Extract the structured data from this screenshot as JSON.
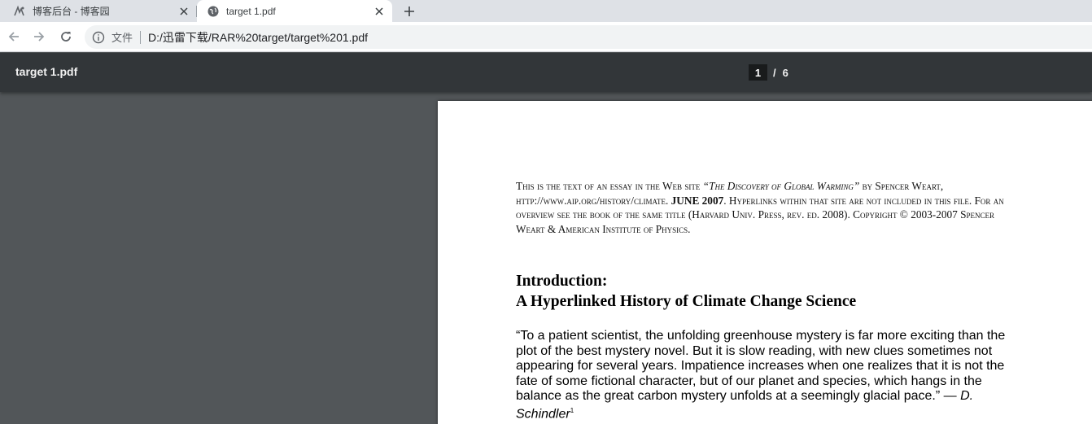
{
  "browser": {
    "tabs": [
      {
        "title": "博客后台 - 博客园",
        "icon": "cnblogs-icon",
        "active": false
      },
      {
        "title": "target 1.pdf",
        "icon": "globe-icon",
        "active": true
      }
    ],
    "new_tab_label": "+",
    "address": {
      "chip": "文件",
      "url": "D:/迅雷下载/RAR%20target/target%201.pdf"
    }
  },
  "pdf_viewer": {
    "document_title": "target 1.pdf",
    "current_page": "1",
    "page_separator": "/",
    "total_pages": "6"
  },
  "page_content": {
    "notice_parts": {
      "p1": "This is the text of an essay in the Web site ",
      "p2": "“The Discovery of Global Warming”",
      "p3": " by Spencer Weart, http://www.aip.org/history/climate. ",
      "p4": "JUNE 2007",
      "p5": ". Hyperlinks within that site are not included in this file.  For an overview see the book of the same title (Harvard Univ. Press, rev. ed. 2008).  Copyright © 2003-2007 Spencer Weart & American Institute of Physics."
    },
    "heading_line1": "Introduction:",
    "heading_line2": "A Hyperlinked History of Climate Change Science",
    "quote_text": "“To a patient scientist, the unfolding greenhouse mystery is far more exciting than the plot of the best mystery novel. But it is slow reading, with new clues sometimes not appearing for several years. Impatience increases when one realizes that it is not the fate of some fictional character, but of our planet and species, which hangs in the balance as the great carbon mystery unfolds at a seemingly glacial pace.” — ",
    "quote_attribution": "D. Schindler",
    "footnote_mark": "1"
  },
  "colors": {
    "tabstrip": "#dee1e6",
    "viewer_toolbar": "#323639",
    "viewer_background": "#525659",
    "page": "#ffffff"
  }
}
